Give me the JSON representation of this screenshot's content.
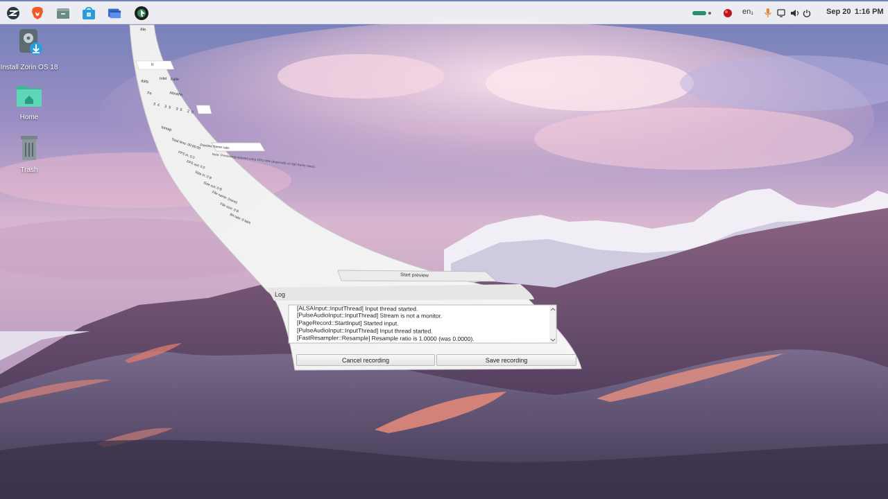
{
  "panel": {
    "apps": [
      {
        "name": "zorin-menu-icon"
      },
      {
        "name": "brave-browser-icon"
      },
      {
        "name": "files-icon"
      },
      {
        "name": "software-store-icon"
      },
      {
        "name": "settings-window-icon"
      },
      {
        "name": "screen-recorder-icon"
      }
    ],
    "keyboard_layout": "en₁",
    "date": "Sep 20",
    "time": "1:16 PM",
    "colors": {
      "battery": "#2a8c6e",
      "record": "#c0151b",
      "mic": "#e8843a"
    }
  },
  "desktop": {
    "items": [
      {
        "label": "Install Zorin OS 18"
      },
      {
        "label": "Home"
      },
      {
        "label": "Trash"
      }
    ]
  },
  "recorder": {
    "log_header": "Log",
    "log_lines": [
      "[ALSAInput::InputThread] Input thread started.",
      "[PulseAudioInput::InputThread] Stream is not a monitor.",
      "[PageRecord::StartInput] Started input.",
      "[PulseAudioInput::InputThread] Input thread started.",
      "[FastResampler::Resample] Resample ratio is 1.0000 (was 0.0000)."
    ],
    "hide_preview_label": "Start preview",
    "cancel_label": "Cancel recording",
    "save_label": "Save recording",
    "warped_labels": {
      "top_tab": "ate",
      "tab_left": "Ir",
      "tab_mid": "ll",
      "section": "asts",
      "row1a": "Infel",
      "row1b": "Falle",
      "row2a": "Fe",
      "row2b": "Abrathe",
      "row3": "34 35 36 20",
      "section2": "tumap",
      "info1": "Total time:  00:00:00",
      "info2": "FPS in:  0.0",
      "info3": "FPS out:  0.0",
      "info4": "Size in:  0 B",
      "info5": "Size out:  0 B",
      "info6": "File name:  (none)",
      "info7": "File size:  0 B",
      "info8": "Bit rate:  0 bit/s",
      "preview_rate": "Preview frame rate:",
      "preview_hint": "Note: Previewing requires extra CPU time (especially at high frame rates)."
    }
  }
}
